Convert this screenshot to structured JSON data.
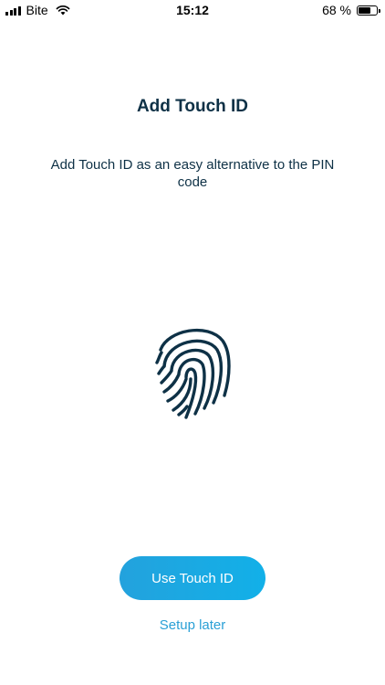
{
  "status_bar": {
    "carrier": "Bite",
    "time": "15:12",
    "battery_text": "68 %",
    "battery_level": 0.68,
    "signal_icon": "cellular-signal-icon",
    "wifi_icon": "wifi-icon",
    "battery_icon": "battery-icon"
  },
  "main": {
    "title": "Add Touch ID",
    "subtitle": "Add Touch ID as an easy alternative to the PIN code",
    "illustration_icon": "fingerprint-icon"
  },
  "actions": {
    "primary_label": "Use Touch ID",
    "secondary_label": "Setup later"
  },
  "colors": {
    "title": "#0e3146",
    "accent": "#1eaae4",
    "link": "#2aa0d6"
  }
}
